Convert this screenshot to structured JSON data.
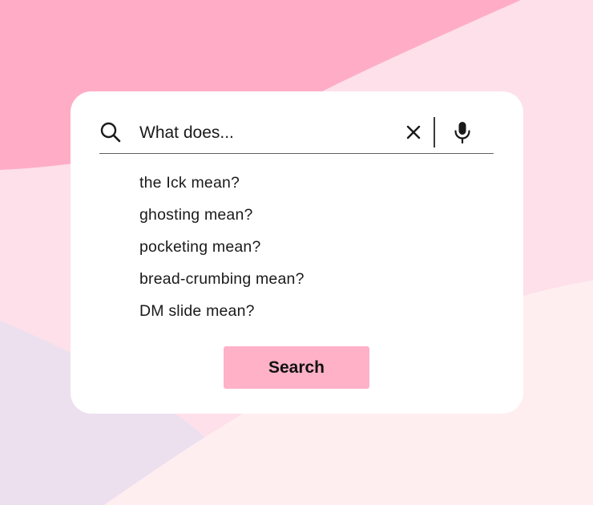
{
  "colors": {
    "background_top": "#ffadc6",
    "background_mid": "#fde0ea",
    "background_left": "#ece0ef",
    "background_bottom": "#ffeef0",
    "card": "#ffffff",
    "button": "#feb1c7"
  },
  "search": {
    "query": "What does...",
    "icon": "search-icon",
    "clear_icon": "close-icon",
    "mic_icon": "microphone-icon"
  },
  "suggestions": [
    "the Ick mean?",
    "ghosting mean?",
    "pocketing mean?",
    "bread-crumbing mean?",
    "DM slide mean?"
  ],
  "button": {
    "label": "Search"
  }
}
